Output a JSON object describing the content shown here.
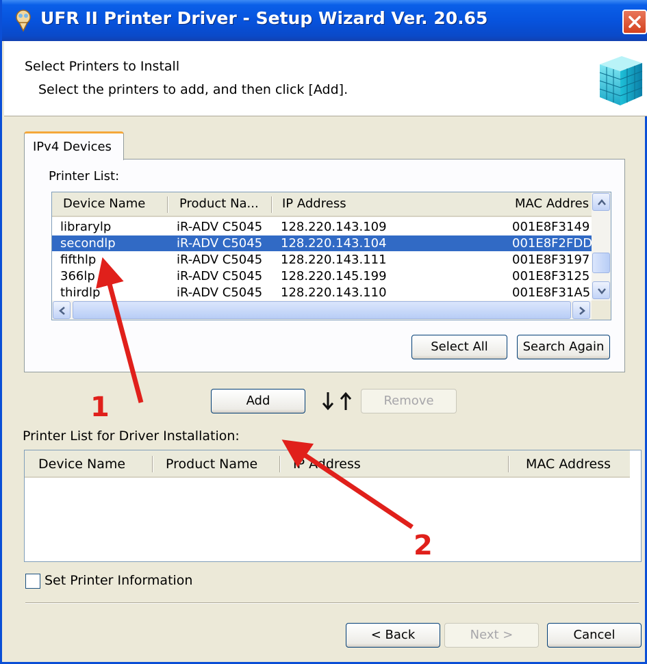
{
  "window": {
    "title": "UFR II Printer Driver - Setup Wizard Ver. 20.65"
  },
  "header": {
    "title": "Select Printers to Install",
    "subtitle": "Select the printers to add, and then click [Add]."
  },
  "tabs": [
    {
      "label": "IPv4 Devices",
      "active": true
    }
  ],
  "printer_list": {
    "label": "Printer List:",
    "columns": [
      "Device Name",
      "Product Na...",
      "IP Address",
      "MAC Addres"
    ],
    "rows": [
      {
        "device": "librarylp",
        "product": "iR-ADV C5045",
        "ip": "128.220.143.109",
        "mac": "001E8F3149"
      },
      {
        "device": "secondlp",
        "product": "iR-ADV C5045",
        "ip": "128.220.143.104",
        "mac": "001E8F2FDD",
        "selected": true
      },
      {
        "device": "fifthlp",
        "product": "iR-ADV C5045",
        "ip": "128.220.143.111",
        "mac": "001E8F3197"
      },
      {
        "device": "366lp",
        "product": "iR-ADV C5045",
        "ip": "128.220.145.199",
        "mac": "001E8F3125"
      },
      {
        "device": "thirdlp",
        "product": "iR-ADV C5045",
        "ip": "128.220.143.110",
        "mac": "001E8F31A5"
      }
    ],
    "select_all_label": "Select All",
    "search_again_label": "Search Again"
  },
  "add_label": "Add",
  "remove_label": "Remove",
  "install_list": {
    "label": "Printer List for Driver Installation:",
    "columns": [
      "Device Name",
      "Product Name",
      "IP Address",
      "MAC Address"
    ]
  },
  "set_printer_info": {
    "label": "Set Printer Information",
    "checked": false
  },
  "footer": {
    "back_label": "< Back",
    "next_label": "Next >",
    "cancel_label": "Cancel"
  },
  "annotations": [
    {
      "label": "1"
    },
    {
      "label": "2"
    }
  ],
  "colors": {
    "title_bar": "#0753dd",
    "selection": "#316ac5",
    "annotation": "#e0201b",
    "tab_highlight": "#f4a73a"
  }
}
